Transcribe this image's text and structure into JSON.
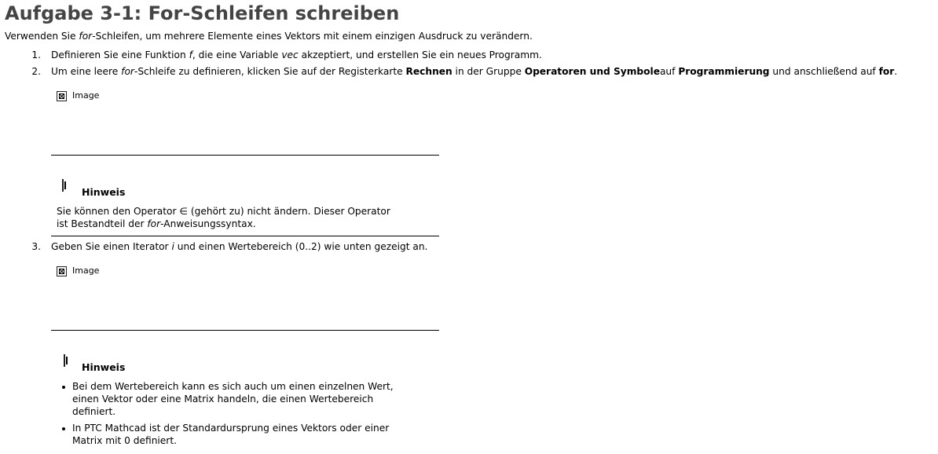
{
  "title": "Aufgabe 3-1: For-Schleifen schreiben",
  "intro": {
    "before": "Verwenden Sie ",
    "em": "for",
    "after": "-Schleifen, um mehrere Elemente eines Vektors mit einem einzigen Ausdruck zu verändern."
  },
  "steps": [
    {
      "number": "1.",
      "t1": "Definieren Sie eine Funktion ",
      "em1": "f",
      "t2": ", die eine Variable ",
      "em2": "vec",
      "t3": " akzeptiert, und erstellen Sie ein neues Programm."
    },
    {
      "number": "2.",
      "t1": "Um eine leere ",
      "em1": "for",
      "t2": "-Schleife zu definieren, klicken Sie auf der Registerkarte ",
      "b1": "Rechnen",
      "t3": " in der Gruppe ",
      "b2": "Operatoren und Symbole",
      "t4": "auf ",
      "b3": "Programmierung",
      "t5": " und anschließend auf ",
      "b4": "for",
      "t6": "."
    },
    {
      "number": "3.",
      "t1": "Geben Sie einen Iterator ",
      "em1": "i",
      "t2": " und einen Wertebereich (0..2) wie unten gezeigt an."
    }
  ],
  "image_label": "Image",
  "note1": {
    "title": "Hinweis",
    "line1": "Sie können den Operator ∈ (gehört zu) nicht ändern. Dieser Operator",
    "line2_before": "ist Bestandteil der ",
    "line2_em": "for",
    "line2_after": "-Anweisungssyntax."
  },
  "note2": {
    "title": "Hinweis",
    "bullet1": [
      "Bei dem Wertebereich kann es sich auch um einen einzelnen Wert,",
      "einen Vektor oder eine Matrix handeln, die einen Wertebereich",
      "definiert."
    ],
    "bullet2": [
      "In PTC Mathcad ist der Standardursprung eines Vektors oder einer",
      "Matrix mit 0 definiert."
    ]
  }
}
